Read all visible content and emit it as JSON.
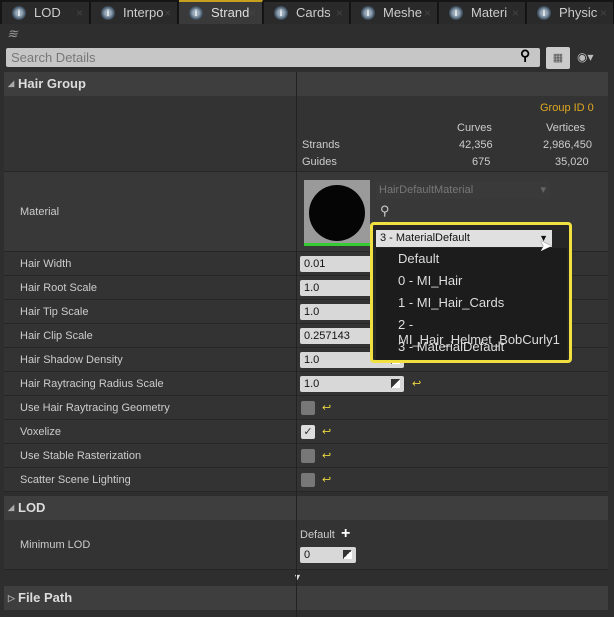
{
  "tabs": [
    {
      "label": "LOD"
    },
    {
      "label": "Interpo"
    },
    {
      "label": "Strand",
      "active": true
    },
    {
      "label": "Cards"
    },
    {
      "label": "Meshe"
    },
    {
      "label": "Materi"
    },
    {
      "label": "Physic"
    }
  ],
  "search": {
    "placeholder": "Search Details"
  },
  "hair_group": {
    "title": "Hair Group",
    "group_id": "Group ID 0",
    "col_curves": "Curves",
    "col_vertices": "Vertices",
    "strands_label": "Strands",
    "strands_curves": "42,356",
    "strands_vertices": "2,986,450",
    "guides_label": "Guides",
    "guides_curves": "675",
    "guides_vertices": "35,020"
  },
  "material": {
    "label": "Material",
    "asset": "HairDefaultMaterial",
    "selected": "3 - MaterialDefault",
    "options": [
      "Default",
      "0 - MI_Hair",
      "1 - MI_Hair_Cards",
      "2 - MI_Hair_Helmet_BobCurly1",
      "3 - MaterialDefault"
    ]
  },
  "props": [
    {
      "label": "Hair Width",
      "value": "0.01"
    },
    {
      "label": "Hair Root Scale",
      "value": "1.0"
    },
    {
      "label": "Hair Tip Scale",
      "value": "1.0"
    },
    {
      "label": "Hair Clip Scale",
      "value": "0.257143"
    },
    {
      "label": "Hair Shadow Density",
      "value": "1.0"
    },
    {
      "label": "Hair Raytracing Radius Scale",
      "value": "1.0"
    }
  ],
  "checks": [
    {
      "label": "Use Hair Raytracing Geometry",
      "checked": false
    },
    {
      "label": "Voxelize",
      "checked": true
    },
    {
      "label": "Use Stable Rasterization",
      "checked": false
    },
    {
      "label": "Scatter Scene Lighting",
      "checked": false
    }
  ],
  "lod": {
    "title": "LOD",
    "min_lod_label": "Minimum LOD",
    "default_label": "Default",
    "value": "0"
  },
  "file_path": {
    "title": "File Path"
  },
  "colors": {
    "accent": "#f0e040",
    "gold": "#e0a820"
  }
}
